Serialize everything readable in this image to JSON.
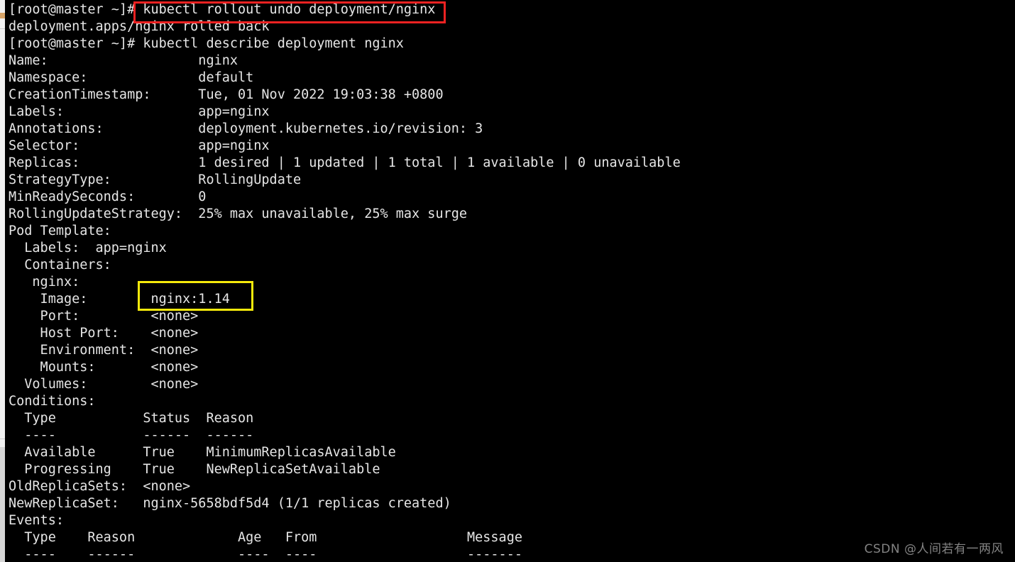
{
  "window": {
    "title": "root@master:~ — kubectl describe deployment nginx",
    "background_color": "#000000",
    "text_color": "#e6e6e6"
  },
  "scrollbar": {
    "name": "vertical-scrollbar",
    "track_color": "#f1f1f1",
    "thumb_color": "#d6d6d6",
    "marker_color": "#d7a468"
  },
  "annotations": {
    "red_box": {
      "color": "#ee2222",
      "target_text": "kubectl rollout undo deployment/nginx"
    },
    "yellow_box": {
      "color": "#f5e90b",
      "target_text": "nginx:1.14"
    }
  },
  "watermark": {
    "text": "CSDN @人间若有一两风"
  },
  "terminal": {
    "prompt": "[root@master ~]#",
    "commands": [
      "kubectl rollout undo deployment/nginx",
      "kubectl describe deployment nginx"
    ],
    "lines": [
      "[root@master ~]# kubectl rollout undo deployment/nginx",
      "deployment.apps/nginx rolled back",
      "[root@master ~]# kubectl describe deployment nginx",
      "Name:                   nginx",
      "Namespace:              default",
      "CreationTimestamp:      Tue, 01 Nov 2022 19:03:38 +0800",
      "Labels:                 app=nginx",
      "Annotations:            deployment.kubernetes.io/revision: 3",
      "Selector:               app=nginx",
      "Replicas:               1 desired | 1 updated | 1 total | 1 available | 0 unavailable",
      "StrategyType:           RollingUpdate",
      "MinReadySeconds:        0",
      "RollingUpdateStrategy:  25% max unavailable, 25% max surge",
      "Pod Template:",
      "  Labels:  app=nginx",
      "  Containers:",
      "   nginx:",
      "    Image:        nginx:1.14",
      "    Port:         <none>",
      "    Host Port:    <none>",
      "    Environment:  <none>",
      "    Mounts:       <none>",
      "  Volumes:        <none>",
      "Conditions:",
      "  Type           Status  Reason",
      "  ----           ------  ------",
      "  Available      True    MinimumReplicasAvailable",
      "  Progressing    True    NewReplicaSetAvailable",
      "OldReplicaSets:  <none>",
      "NewReplicaSet:   nginx-5658bdf5d4 (1/1 replicas created)",
      "Events:",
      "  Type    Reason             Age   From                   Message",
      "  ----    ------             ----  ----                   -------"
    ],
    "describe": {
      "name": "nginx",
      "namespace": "default",
      "creation_timestamp": "Tue, 01 Nov 2022 19:03:38 +0800",
      "labels": "app=nginx",
      "annotations": "deployment.kubernetes.io/revision: 3",
      "selector": "app=nginx",
      "replicas": "1 desired | 1 updated | 1 total | 1 available | 0 unavailable",
      "strategy_type": "RollingUpdate",
      "min_ready_seconds": "0",
      "rolling_update_strategy": "25% max unavailable, 25% max surge",
      "pod_template": {
        "labels": "app=nginx",
        "container_name": "nginx",
        "image": "nginx:1.14",
        "port": "<none>",
        "host_port": "<none>",
        "environment": "<none>",
        "mounts": "<none>"
      },
      "volumes": "<none>",
      "conditions": {
        "headers": [
          "Type",
          "Status",
          "Reason"
        ],
        "rows": [
          [
            "Available",
            "True",
            "MinimumReplicasAvailable"
          ],
          [
            "Progressing",
            "True",
            "NewReplicaSetAvailable"
          ]
        ]
      },
      "old_replica_sets": "<none>",
      "new_replica_set": "nginx-5658bdf5d4 (1/1 replicas created)",
      "events": {
        "headers": [
          "Type",
          "Reason",
          "Age",
          "From",
          "Message"
        ]
      }
    },
    "rollback_output": "deployment.apps/nginx rolled back"
  }
}
